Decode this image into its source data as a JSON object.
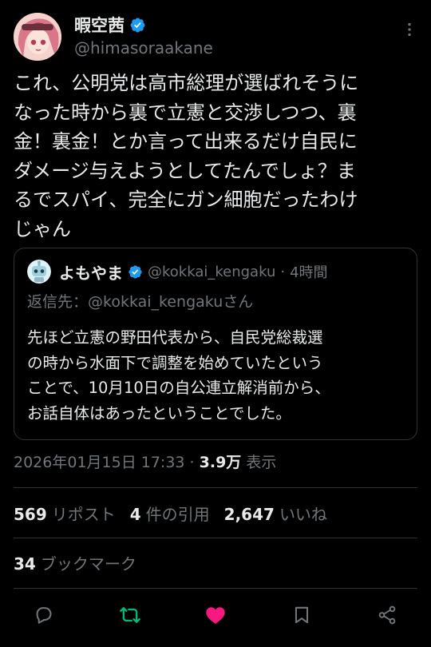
{
  "author": {
    "display_name": "暇空茜",
    "handle": "@himasoraakane",
    "avatar_icon": "anime-girl-avatar",
    "verified": true
  },
  "tweet": {
    "text": "これ、公明党は高市総理が選ばれそうに\nなった時から裏で立憲と交渉しつつ、裏\n金！裏金！とか言って出来るだけ自民に\nダメージ与えようとしてたんでしょ？ま\nるでスパイ、完全にガン細胞だったわけ\nじゃん"
  },
  "quote": {
    "display_name": "よもやま",
    "handle": "@kokkai_kengaku",
    "separator": "·",
    "time": "4時間",
    "reply_to": "返信先：@kokkai_kengakuさん",
    "text": "先ほど立憲の野田代表から、自民党総裁選\nの時から水面下で調整を始めていたという\nことで、10月10日の自公連立解消前から、\nお話自体はあったということでした。",
    "avatar_icon": "robot-avatar"
  },
  "meta": {
    "timestamp": "2026年01月15日 17:33",
    "separator": " · ",
    "views_count": "3.9万",
    "views_label": " 表示"
  },
  "stats": {
    "reposts_count": "569",
    "reposts_label": "リポスト",
    "quotes_count": "4",
    "quotes_label": "件の引用",
    "likes_count": "2,647",
    "likes_label": "いいね",
    "bookmarks_count": "34",
    "bookmarks_label": "ブックマーク"
  },
  "colors": {
    "background": "#000000",
    "text": "#e7e9ea",
    "muted": "#71767b",
    "border": "#2f3336",
    "verified_blue": "#1d9bf0",
    "repost_green": "#00ba7c",
    "like_pink": "#f91880"
  },
  "actions": [
    "reply-icon",
    "repost-icon",
    "like-icon",
    "bookmark-icon",
    "share-icon"
  ]
}
